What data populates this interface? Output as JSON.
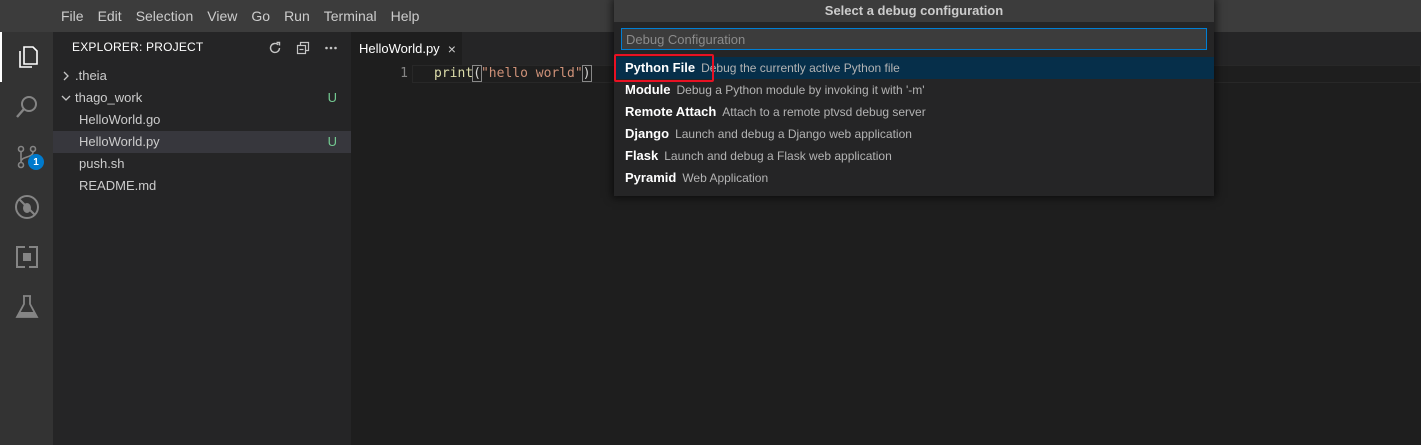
{
  "menu": [
    "File",
    "Edit",
    "Selection",
    "View",
    "Go",
    "Run",
    "Terminal",
    "Help"
  ],
  "activity": {
    "items": [
      "explorer-icon",
      "search-icon",
      "source-control-icon",
      "debug-icon",
      "extensions-icon",
      "test-flask-icon"
    ],
    "scm_badge": "1"
  },
  "explorer": {
    "title": "EXPLORER: PROJECT",
    "actions": [
      "refresh-icon",
      "collapse-all-icon",
      "more-actions-icon"
    ],
    "tree": [
      {
        "label": ".theia",
        "status": ""
      },
      {
        "label": "thago_work",
        "status": "U"
      },
      {
        "label": "HelloWorld.go",
        "status": ""
      },
      {
        "label": "HelloWorld.py",
        "status": "U"
      },
      {
        "label": "push.sh",
        "status": ""
      },
      {
        "label": "README.md",
        "status": ""
      }
    ]
  },
  "editor": {
    "tab_label": "HelloWorld.py",
    "tab_close": "×",
    "line_number": "1",
    "code": {
      "fn": "print",
      "open": "(",
      "str": "\"hello world\"",
      "close": ")"
    }
  },
  "quick_pick": {
    "title": "Select a debug configuration",
    "placeholder": "Debug Configuration",
    "value": "",
    "items": [
      {
        "label": "Python File",
        "description": "Debug the currently active Python file"
      },
      {
        "label": "Module",
        "description": "Debug a Python module by invoking it with '-m'"
      },
      {
        "label": "Remote Attach",
        "description": "Attach to a remote ptvsd debug server"
      },
      {
        "label": "Django",
        "description": "Launch and debug a Django web application"
      },
      {
        "label": "Flask",
        "description": "Launch and debug a Flask web application"
      },
      {
        "label": "Pyramid",
        "description": "Web Application"
      }
    ]
  },
  "colors": {
    "accent": "#007acc",
    "highlight_box": "#e81123",
    "untracked": "#73c991"
  }
}
